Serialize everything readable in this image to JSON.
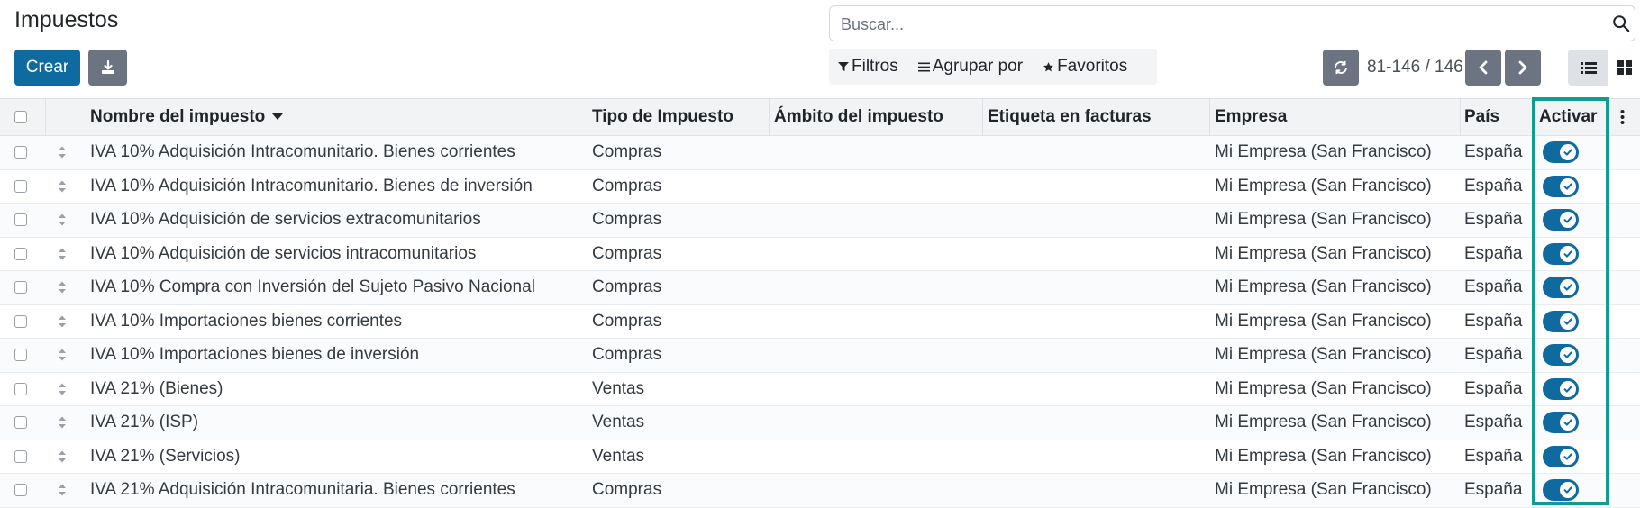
{
  "page": {
    "title": "Impuestos"
  },
  "search": {
    "placeholder": "Buscar..."
  },
  "toolbar": {
    "create_label": "Crear"
  },
  "filters": {
    "filters_label": "Filtros",
    "group_label": "Agrupar por",
    "favorites_label": "Favoritos"
  },
  "pager": {
    "value": "81-146 / 146"
  },
  "colors": {
    "primary": "#0f6aa0",
    "secondary": "#6b7480",
    "highlight": "#0f9d91"
  },
  "icons": {
    "search": "search-icon",
    "download": "download-icon",
    "filter": "filter-icon",
    "group": "list-lines-icon",
    "favorite": "star-icon",
    "refresh": "refresh-icon",
    "prev": "chevron-left-icon",
    "next": "chevron-right-icon",
    "list_view": "list-view-icon",
    "kanban_view": "kanban-view-icon",
    "optional_columns": "more-vertical-icon"
  },
  "table": {
    "columns": {
      "name": "Nombre del impuesto",
      "type": "Tipo de Impuesto",
      "scope": "Ámbito del impuesto",
      "label": "Etiqueta en facturas",
      "company": "Mi Empresa",
      "company_header": "Empresa",
      "country": "País",
      "active": "Activar"
    },
    "rows": [
      {
        "name": "IVA 10% Adquisición Intracomunitario. Bienes corrientes",
        "type": "Compras",
        "scope": "",
        "label": "",
        "company": "Mi Empresa (San Francisco)",
        "country": "España",
        "active": true
      },
      {
        "name": "IVA 10% Adquisición Intracomunitario. Bienes de inversión",
        "type": "Compras",
        "scope": "",
        "label": "",
        "company": "Mi Empresa (San Francisco)",
        "country": "España",
        "active": true
      },
      {
        "name": "IVA 10% Adquisición de servicios extracomunitarios",
        "type": "Compras",
        "scope": "",
        "label": "",
        "company": "Mi Empresa (San Francisco)",
        "country": "España",
        "active": true
      },
      {
        "name": "IVA 10% Adquisición de servicios intracomunitarios",
        "type": "Compras",
        "scope": "",
        "label": "",
        "company": "Mi Empresa (San Francisco)",
        "country": "España",
        "active": true
      },
      {
        "name": "IVA 10% Compra con Inversión del Sujeto Pasivo Nacional",
        "type": "Compras",
        "scope": "",
        "label": "",
        "company": "Mi Empresa (San Francisco)",
        "country": "España",
        "active": true
      },
      {
        "name": "IVA 10% Importaciones bienes corrientes",
        "type": "Compras",
        "scope": "",
        "label": "",
        "company": "Mi Empresa (San Francisco)",
        "country": "España",
        "active": true
      },
      {
        "name": "IVA 10% Importaciones bienes de inversión",
        "type": "Compras",
        "scope": "",
        "label": "",
        "company": "Mi Empresa (San Francisco)",
        "country": "España",
        "active": true
      },
      {
        "name": "IVA 21% (Bienes)",
        "type": "Ventas",
        "scope": "",
        "label": "",
        "company": "Mi Empresa (San Francisco)",
        "country": "España",
        "active": true
      },
      {
        "name": "IVA 21% (ISP)",
        "type": "Ventas",
        "scope": "",
        "label": "",
        "company": "Mi Empresa (San Francisco)",
        "country": "España",
        "active": true
      },
      {
        "name": "IVA 21% (Servicios)",
        "type": "Ventas",
        "scope": "",
        "label": "",
        "company": "Mi Empresa (San Francisco)",
        "country": "España",
        "active": true
      },
      {
        "name": "IVA 21% Adquisición Intracomunitaria. Bienes corrientes",
        "type": "Compras",
        "scope": "",
        "label": "",
        "company": "Mi Empresa (San Francisco)",
        "country": "España",
        "active": true
      }
    ]
  }
}
